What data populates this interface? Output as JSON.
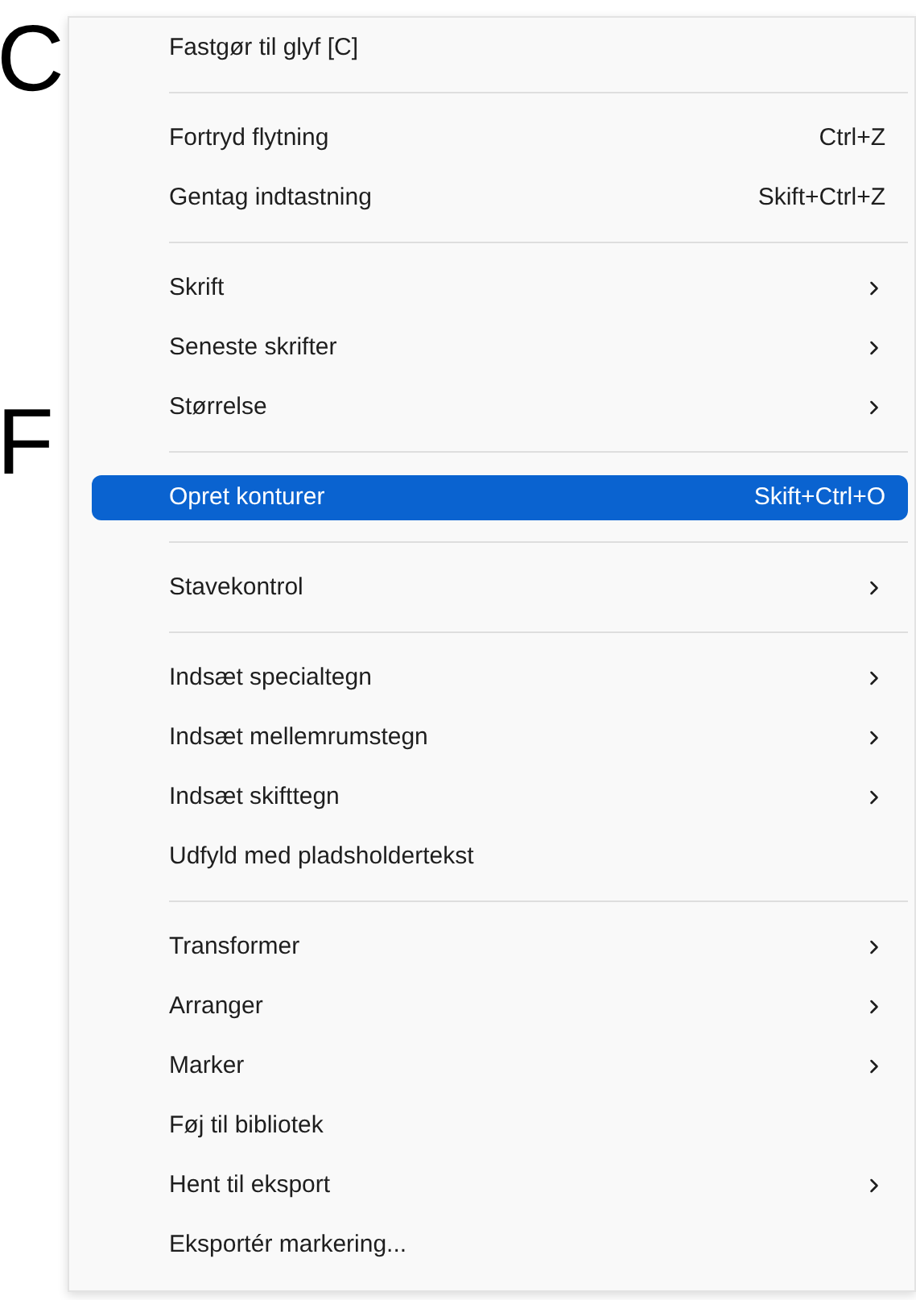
{
  "canvas": {
    "glyphs": [
      "C",
      "F"
    ]
  },
  "menu": {
    "sections": [
      [
        {
          "label": "Fastgør til glyf [C]",
          "submenu": false,
          "selected": false
        }
      ],
      [
        {
          "label": "Fortryd flytning",
          "shortcut": "Ctrl+Z",
          "submenu": false,
          "selected": false
        },
        {
          "label": "Gentag indtastning",
          "shortcut": "Skift+Ctrl+Z",
          "submenu": false,
          "selected": false
        }
      ],
      [
        {
          "label": "Skrift",
          "submenu": true,
          "selected": false
        },
        {
          "label": "Seneste skrifter",
          "submenu": true,
          "selected": false
        },
        {
          "label": "Størrelse",
          "submenu": true,
          "selected": false
        }
      ],
      [
        {
          "label": "Opret konturer",
          "shortcut": "Skift+Ctrl+O",
          "submenu": false,
          "selected": true
        }
      ],
      [
        {
          "label": "Stavekontrol",
          "submenu": true,
          "selected": false
        }
      ],
      [
        {
          "label": "Indsæt specialtegn",
          "submenu": true,
          "selected": false
        },
        {
          "label": "Indsæt mellemrumstegn",
          "submenu": true,
          "selected": false
        },
        {
          "label": "Indsæt skifttegn",
          "submenu": true,
          "selected": false
        },
        {
          "label": "Udfyld med pladsholdertekst",
          "submenu": false,
          "selected": false
        }
      ],
      [
        {
          "label": "Transformer",
          "submenu": true,
          "selected": false
        },
        {
          "label": "Arranger",
          "submenu": true,
          "selected": false
        },
        {
          "label": "Marker",
          "submenu": true,
          "selected": false
        },
        {
          "label": "Føj til bibliotek",
          "submenu": false,
          "selected": false
        },
        {
          "label": "Hent til eksport",
          "submenu": true,
          "selected": false
        },
        {
          "label": "Eksportér markering...",
          "submenu": false,
          "selected": false
        }
      ]
    ]
  }
}
